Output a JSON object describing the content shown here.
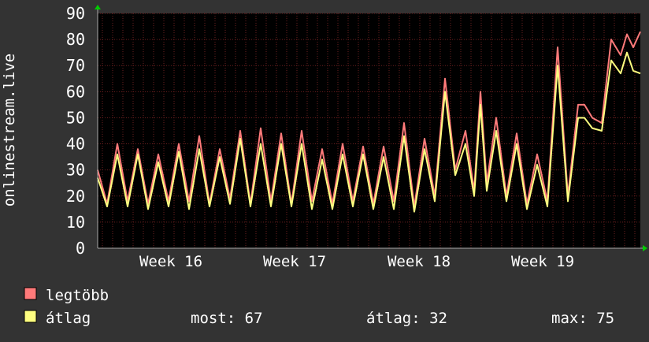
{
  "chart_data": {
    "type": "line",
    "ylabel": "onlinestream.live",
    "ylim": [
      0,
      90
    ],
    "yticks": [
      "0",
      "10",
      "20",
      "30",
      "40",
      "50",
      "60",
      "70",
      "80",
      "90"
    ],
    "xticks": [
      "Week 16",
      "Week 17",
      "Week 18",
      "Week 19"
    ],
    "xlim": [
      0,
      689
    ],
    "grid": true,
    "background": "#000000",
    "frame_color": "#333333",
    "grid_color": "#6b1f1f",
    "axis_arrow_color": "#00cc00",
    "x_tick_positions": [
      81,
      238,
      396,
      553
    ],
    "series": [
      {
        "name": "legtöbb",
        "color": "#ff7a7a",
        "x": [
          0,
          12,
          25,
          38,
          51,
          64,
          77,
          90,
          103,
          116,
          129,
          142,
          155,
          168,
          181,
          194,
          207,
          220,
          233,
          246,
          259,
          272,
          285,
          298,
          311,
          324,
          337,
          350,
          363,
          376,
          389,
          402,
          415,
          428,
          441,
          454,
          467,
          478,
          486,
          494,
          506,
          519,
          532,
          545,
          558,
          571,
          584,
          597,
          610,
          618,
          628,
          640,
          652,
          664,
          672,
          680,
          689
        ],
        "values": [
          30,
          17,
          40,
          18,
          38,
          17,
          36,
          18,
          40,
          18,
          43,
          17,
          38,
          19,
          45,
          17,
          46,
          18,
          44,
          17,
          45,
          18,
          38,
          17,
          40,
          18,
          39,
          17,
          39,
          18,
          48,
          16,
          42,
          20,
          65,
          30,
          45,
          22,
          60,
          25,
          50,
          20,
          44,
          17,
          36,
          18,
          77,
          20,
          55,
          55,
          50,
          48,
          80,
          74,
          82,
          77,
          83
        ]
      },
      {
        "name": "átlag",
        "color": "#ffff80",
        "x": [
          0,
          12,
          25,
          38,
          51,
          64,
          77,
          90,
          103,
          116,
          129,
          142,
          155,
          168,
          181,
          194,
          207,
          220,
          233,
          246,
          259,
          272,
          285,
          298,
          311,
          324,
          337,
          350,
          363,
          376,
          389,
          402,
          415,
          428,
          441,
          454,
          467,
          478,
          486,
          494,
          506,
          519,
          532,
          545,
          558,
          571,
          584,
          597,
          610,
          618,
          628,
          640,
          652,
          664,
          672,
          680,
          689
        ],
        "values": [
          27,
          16,
          36,
          16,
          36,
          15,
          33,
          16,
          37,
          15,
          38,
          16,
          35,
          17,
          42,
          16,
          40,
          16,
          40,
          16,
          40,
          15,
          34,
          15,
          36,
          16,
          36,
          15,
          35,
          15,
          43,
          14,
          38,
          18,
          60,
          28,
          40,
          20,
          55,
          22,
          45,
          18,
          40,
          15,
          32,
          16,
          70,
          18,
          50,
          50,
          46,
          45,
          72,
          67,
          75,
          68,
          67
        ]
      }
    ]
  },
  "legend": {
    "items": [
      {
        "label": "legtöbb",
        "color": "#ff7a7a"
      },
      {
        "label": "átlag",
        "color": "#ffff80"
      }
    ],
    "stats": {
      "most": "most: 67",
      "atlag": "átlag: 32",
      "max": "max: 75"
    }
  }
}
